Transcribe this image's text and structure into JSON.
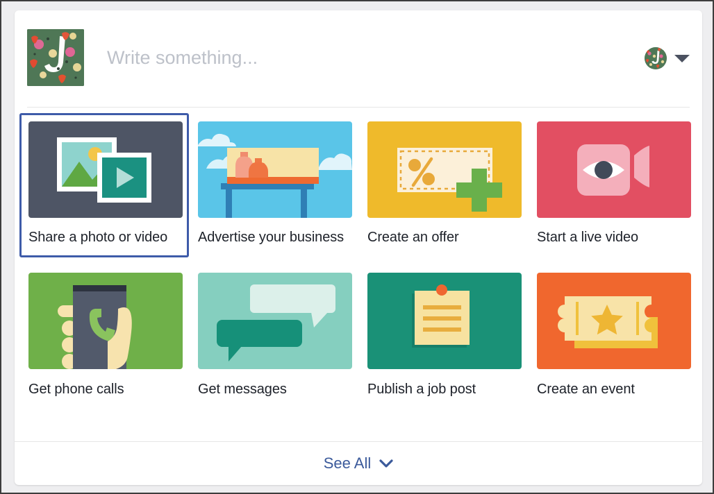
{
  "composer": {
    "placeholder": "Write something...",
    "avatar_alt": "page-profile-photo",
    "audience_chevron": "chevron-down-icon"
  },
  "tiles": [
    {
      "id": "share-photo-or-video",
      "label": "Share a photo or video",
      "selected": true,
      "icon": "photo-video-icon",
      "colors": {
        "bg": "#4e5565",
        "accent": "#1b9181",
        "sky": "#8ed3cd",
        "sun": "#f3c64a",
        "hill": "#5fa843"
      }
    },
    {
      "id": "advertise-your-business",
      "label": "Advertise your business",
      "selected": false,
      "icon": "billboard-icon",
      "colors": {
        "bg": "#5ac5e8",
        "panel": "#f7e3a7",
        "strip": "#ee6a31",
        "post": "#2f7fb5"
      }
    },
    {
      "id": "create-an-offer",
      "label": "Create an offer",
      "selected": false,
      "icon": "coupon-percent-icon",
      "colors": {
        "bg": "#efba2b",
        "coupon": "#fcf0d9",
        "percent": "#e8a93a",
        "plus": "#69b04b"
      }
    },
    {
      "id": "start-a-live-video",
      "label": "Start a live video",
      "selected": false,
      "icon": "live-video-eye-icon",
      "colors": {
        "bg": "#e24f62",
        "camera": "#f4afbb",
        "eye": "#ffffff",
        "pupil": "#414a59"
      }
    },
    {
      "id": "get-phone-calls",
      "label": "Get phone calls",
      "selected": false,
      "icon": "hand-phone-icon",
      "colors": {
        "bg": "#6fb049",
        "phone": "#525a6b",
        "hand": "#f7e3ae",
        "handset": "#8ac35e"
      }
    },
    {
      "id": "get-messages",
      "label": "Get messages",
      "selected": false,
      "icon": "speech-bubbles-icon",
      "colors": {
        "bg": "#85cfbf",
        "bubble_light": "#dcf0ea",
        "bubble_dark": "#169079"
      }
    },
    {
      "id": "publish-a-job-post",
      "label": "Publish a job post",
      "selected": false,
      "icon": "pinned-note-icon",
      "colors": {
        "bg": "#1a9177",
        "paper": "#f7e2a0",
        "lines": "#e8ad3e",
        "pin": "#ef6630"
      }
    },
    {
      "id": "create-an-event",
      "label": "Create an event",
      "selected": false,
      "icon": "ticket-star-icon",
      "colors": {
        "bg": "#f0672e",
        "ticket_front": "#f8e3a8",
        "ticket_back": "#f0c13c",
        "star": "#eeb634"
      }
    }
  ],
  "footer": {
    "see_all_label": "See All",
    "see_all_chevron": "chevron-down-icon",
    "see_all_color": "#3b5a9b"
  }
}
